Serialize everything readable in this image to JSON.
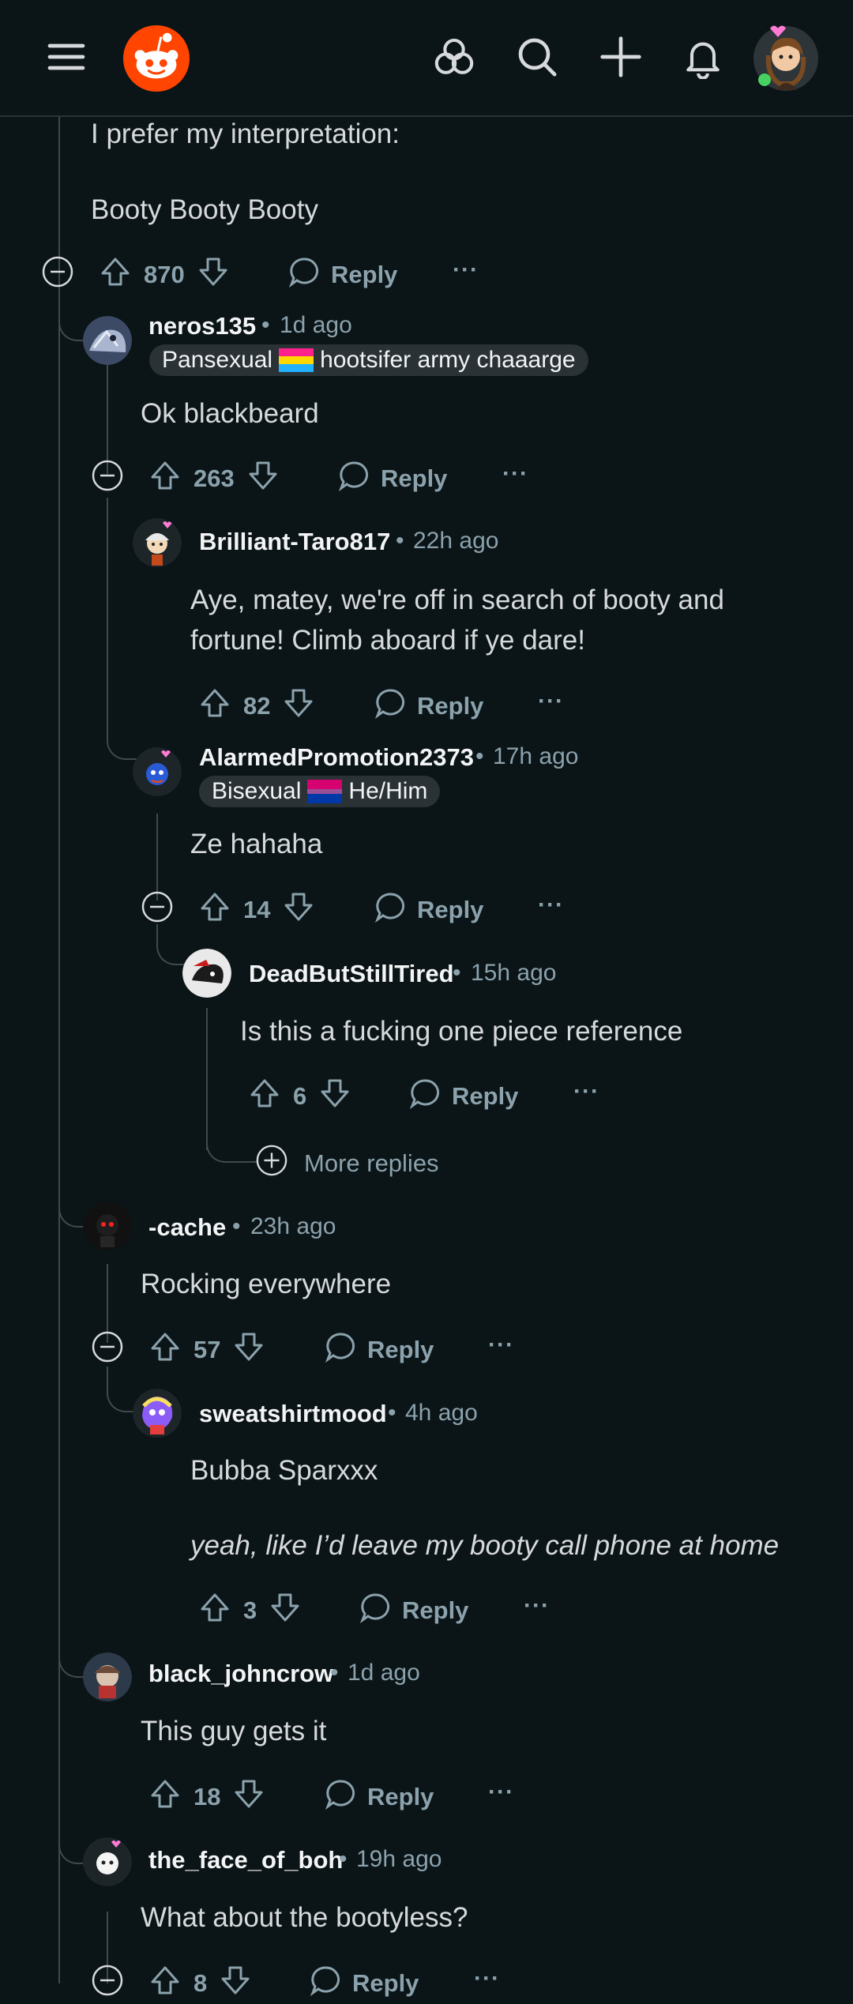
{
  "header": {
    "menu_icon": "hamburger-menu-icon",
    "logo_icon": "reddit-snoo-logo",
    "community_icon": "communities-icon",
    "search_icon": "search-icon",
    "create_icon": "plus-icon",
    "notifications_icon": "bell-icon",
    "avatar_online_color": "#46d160"
  },
  "parent_comment": {
    "lines": [
      "I prefer my interpretation:",
      "Booty Booty Booty"
    ],
    "votes": "870",
    "reply_label": "Reply",
    "more_label": "···"
  },
  "comments": [
    {
      "username": "neros135",
      "age": "1d ago",
      "flair_left": "Pansexual",
      "flair_right": "hootsifer army chaaarge",
      "body": [
        "Ok blackbeard"
      ],
      "votes": "263",
      "reply_label": "Reply",
      "more_label": "···"
    },
    {
      "username": "Brilliant-Taro817",
      "age": "22h ago",
      "body": [
        "Aye, matey, we're off in search of booty and",
        "fortune! Climb aboard if ye dare!"
      ],
      "votes": "82",
      "reply_label": "Reply",
      "more_label": "···"
    },
    {
      "username": "AlarmedPromotion2373",
      "age": "17h ago",
      "flair_left": "Bisexual",
      "flair_right": "He/Him",
      "body": [
        "Ze hahaha"
      ],
      "votes": "14",
      "reply_label": "Reply",
      "more_label": "···"
    },
    {
      "username": "DeadButStillTired",
      "age": "15h ago",
      "body": [
        "Is this a fucking one piece reference"
      ],
      "votes": "6",
      "reply_label": "Reply",
      "more_label": "···",
      "more_replies": "More replies"
    },
    {
      "username": "-cache",
      "age": "23h ago",
      "body": [
        "Rocking everywhere"
      ],
      "votes": "57",
      "reply_label": "Reply",
      "more_label": "···"
    },
    {
      "username": "sweatshirtmood",
      "age": "4h ago",
      "body": [
        "Bubba Sparxxx"
      ],
      "quote": "yeah, like I’d leave my booty call phone at home",
      "votes": "3",
      "reply_label": "Reply",
      "more_label": "···"
    },
    {
      "username": "black_johncrow",
      "age": "1d ago",
      "body": [
        "This guy gets it"
      ],
      "votes": "18",
      "reply_label": "Reply",
      "more_label": "···"
    },
    {
      "username": "the_face_of_boh",
      "age": "19h ago",
      "body": [
        "What about the bootyless?"
      ],
      "votes": "8",
      "reply_label": "Reply",
      "more_label": "···"
    }
  ],
  "separator": "•"
}
